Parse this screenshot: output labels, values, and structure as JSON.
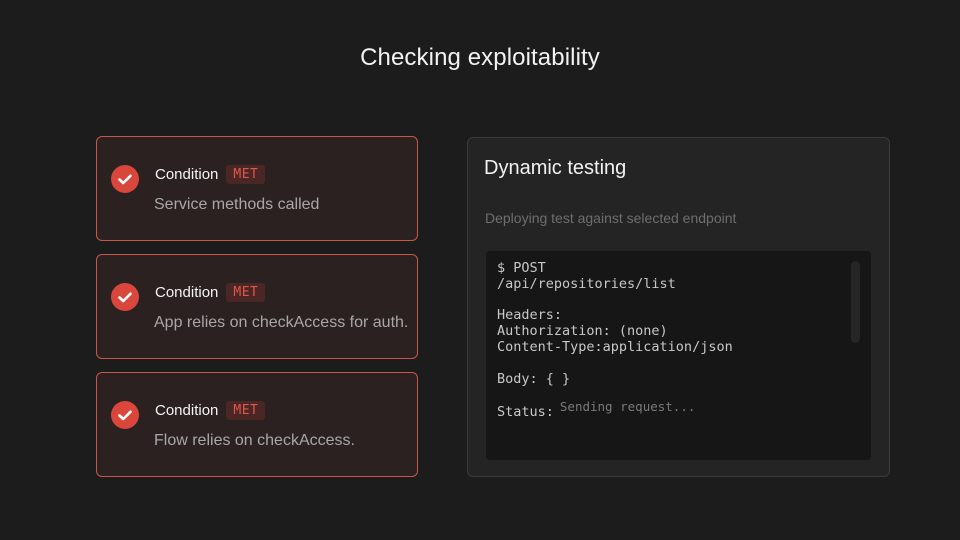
{
  "page": {
    "title": "Checking exploitability"
  },
  "conditions": [
    {
      "label": "Condition",
      "status": "MET",
      "description": "Service methods called"
    },
    {
      "label": "Condition",
      "status": "MET",
      "description": "App relies on checkAccess for auth."
    },
    {
      "label": "Condition",
      "status": "MET",
      "description": "Flow relies on checkAccess."
    }
  ],
  "testing": {
    "title": "Dynamic testing",
    "subtitle": "Deploying test against selected endpoint",
    "terminal": {
      "method_line": "$ POST",
      "path_line": "/api/repositories/list",
      "headers_label": "Headers:",
      "authorization_line": "Authorization: (none)",
      "content_type_line": "Content-Type:application/json",
      "body_line": "Body: { }",
      "status_label": "Status:",
      "status_value": "Sending request..."
    }
  },
  "colors": {
    "background": "#1c1c1c",
    "accent_red": "#d9473c",
    "card_border": "#c9564a",
    "panel_bg": "#242424",
    "terminal_bg": "#161616"
  },
  "icons": {
    "condition_check": "check-circle-icon"
  }
}
